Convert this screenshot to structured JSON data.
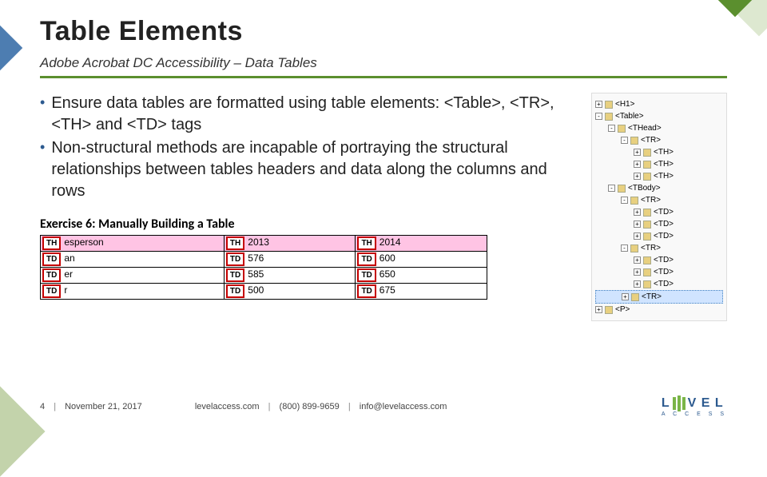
{
  "title": "Table Elements",
  "subtitle": "Adobe Acrobat DC Accessibility – Data Tables",
  "bullets": [
    "Ensure data tables are formatted using table elements:    <Table>, <TR>, <TH> and <TD> tags",
    "Non-structural methods are incapable of portraying the structural relationships between tables headers and data along the columns and rows"
  ],
  "exercise_title": "Exercise 6: Manually Building a Table",
  "example_table": {
    "tags": {
      "th": "TH",
      "td": "TD"
    },
    "rows": [
      {
        "tag": "th",
        "cells": [
          "esperson",
          "2013",
          "2014"
        ]
      },
      {
        "tag": "td",
        "cells": [
          "an",
          "576",
          "600"
        ]
      },
      {
        "tag": "td",
        "cells": [
          "er",
          "585",
          "650"
        ]
      },
      {
        "tag": "td",
        "cells": [
          "r",
          "500",
          "675"
        ]
      }
    ]
  },
  "tree": [
    {
      "indent": 0,
      "toggle": "+",
      "label": "<H1>"
    },
    {
      "indent": 0,
      "toggle": "-",
      "label": "<Table>"
    },
    {
      "indent": 16,
      "toggle": "-",
      "label": "<THead>"
    },
    {
      "indent": 32,
      "toggle": "-",
      "label": "<TR>"
    },
    {
      "indent": 48,
      "toggle": "+",
      "label": "<TH>"
    },
    {
      "indent": 48,
      "toggle": "+",
      "label": "<TH>"
    },
    {
      "indent": 48,
      "toggle": "+",
      "label": "<TH>"
    },
    {
      "indent": 16,
      "toggle": "-",
      "label": "<TBody>"
    },
    {
      "indent": 32,
      "toggle": "-",
      "label": "<TR>"
    },
    {
      "indent": 48,
      "toggle": "+",
      "label": "<TD>"
    },
    {
      "indent": 48,
      "toggle": "+",
      "label": "<TD>"
    },
    {
      "indent": 48,
      "toggle": "+",
      "label": "<TD>"
    },
    {
      "indent": 32,
      "toggle": "-",
      "label": "<TR>"
    },
    {
      "indent": 48,
      "toggle": "+",
      "label": "<TD>"
    },
    {
      "indent": 48,
      "toggle": "+",
      "label": "<TD>"
    },
    {
      "indent": 48,
      "toggle": "+",
      "label": "<TD>"
    },
    {
      "indent": 32,
      "toggle": "+",
      "label": "<TR>",
      "hl": true
    },
    {
      "indent": 0,
      "toggle": "+",
      "label": "<P>"
    }
  ],
  "footer": {
    "page": "4",
    "date": "November 21, 2017",
    "site": "levelaccess.com",
    "phone": "(800) 899-9659",
    "email": "info@levelaccess.com"
  },
  "logo": {
    "top": "L   V E L",
    "bottom": "A C C E S S"
  }
}
